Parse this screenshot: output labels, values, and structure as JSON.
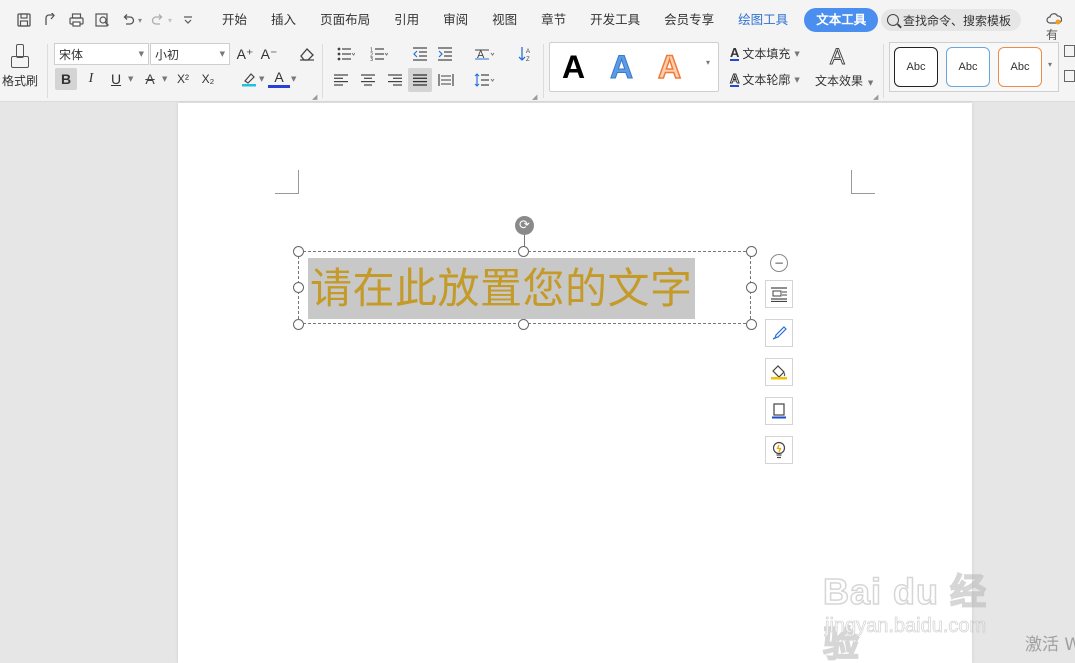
{
  "quick_access": {
    "icons": [
      "save-icon",
      "share-icon",
      "print-icon",
      "print-preview-icon",
      "undo-icon",
      "redo-icon",
      "customize-icon"
    ]
  },
  "menu": {
    "tabs": [
      "开始",
      "插入",
      "页面布局",
      "引用",
      "审阅",
      "视图",
      "章节",
      "开发工具",
      "会员专享",
      "绘图工具",
      "文本工具"
    ],
    "active_tab": "文本工具",
    "search_placeholder": "查找命令、搜索模板",
    "right_label": "有"
  },
  "ribbon": {
    "format_painter": "格式刷",
    "font_name": "宋体",
    "font_size": "小初",
    "font_grow": "A⁺",
    "font_shrink": "A⁻",
    "bold": "B",
    "italic": "I",
    "underline": "U",
    "strike": "A",
    "superscript": "X²",
    "subscript": "X₂",
    "font_color": "A",
    "text_fill": "文本填充",
    "text_outline": "文本轮廓",
    "text_effect": "文本效果",
    "wordart_sample": "A",
    "shape_style_sample": "Abc",
    "accent_color": "#4a8ef0"
  },
  "document": {
    "textbox_text": "请在此放置您的文字",
    "text_color": "#c49a28",
    "highlight_color": "#c8c8c8"
  },
  "watermark": {
    "brand": "Bai du 经验",
    "url": "jingyan.baidu.com"
  },
  "system": {
    "activate_text": "激活 W"
  }
}
